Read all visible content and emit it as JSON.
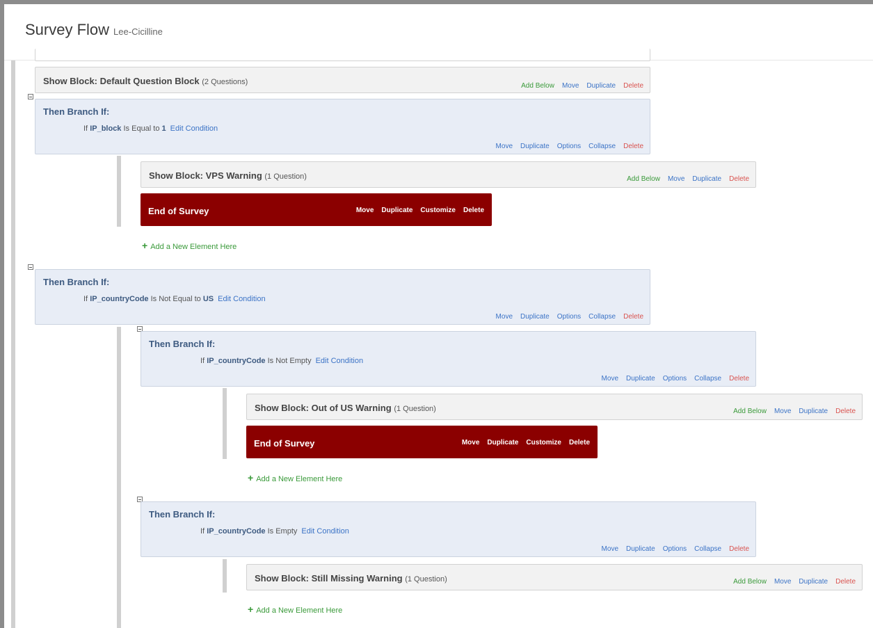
{
  "page": {
    "title": "Survey Flow",
    "subtitle": "Lee-Cicilline"
  },
  "actions": {
    "add_below": "Add Below",
    "move": "Move",
    "duplicate": "Duplicate",
    "delete": "Delete",
    "options": "Options",
    "collapse": "Collapse",
    "customize": "Customize"
  },
  "add_element_label": "Add a New Element Here",
  "blocks": {
    "default": {
      "label": "Show Block: Default Question Block",
      "count": "(2 Questions)"
    },
    "vps": {
      "label": "Show Block: VPS Warning",
      "count": "(1 Question)"
    },
    "outofus": {
      "label": "Show Block: Out of US Warning",
      "count": "(1 Question)"
    },
    "missing": {
      "label": "Show Block: Still Missing Warning",
      "count": "(1 Question)"
    }
  },
  "end_of_survey": "End of Survey",
  "branches": {
    "title": "Then Branch If:",
    "edit_condition": "Edit Condition",
    "b1": {
      "prefix": "If",
      "field": "IP_block",
      "op": "Is Equal to",
      "value": "1"
    },
    "b2": {
      "prefix": "If",
      "field": "IP_countryCode",
      "op": "Is Not Equal to",
      "value": "US"
    },
    "b3": {
      "prefix": "If",
      "field": "IP_countryCode",
      "op": "Is Not Empty"
    },
    "b4": {
      "prefix": "If",
      "field": "IP_countryCode",
      "op": "Is Empty"
    }
  },
  "colors": {
    "end_block": "#8b0000",
    "branch_bg": "#e8edf6",
    "block_bg": "#f2f2f2",
    "link_blue": "#3b73c6",
    "add_green": "#3a9a3a",
    "delete_red": "#d9534f"
  }
}
